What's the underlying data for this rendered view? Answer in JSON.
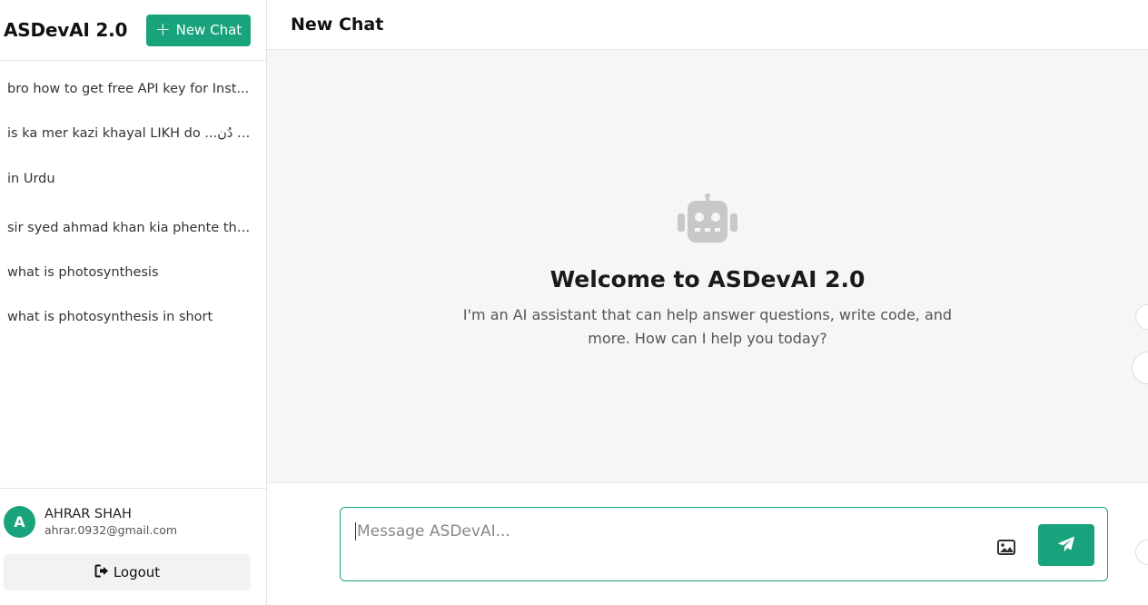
{
  "sidebar": {
    "brand": "ASDevAI 2.0",
    "new_chat_label": "New Chat",
    "history": [
      "bro how to get free API key for Inst...",
      "is ka mer kazi khayal LIKH do ...اری دُن",
      "in Urdu",
      "sir syed ahmad khan kia phente the...",
      "what is photosynthesis",
      "what is photosynthesis in short"
    ],
    "user": {
      "initial": "A",
      "name": "AHRAR SHAH",
      "email": "ahrar.0932@gmail.com"
    },
    "logout_label": "Logout"
  },
  "main": {
    "title": "New Chat",
    "welcome_title": "Welcome to ASDevAI 2.0",
    "welcome_text": "I'm an AI assistant that can help answer questions, write code, and more. How can I help you today?",
    "input_placeholder": "Message ASDevAI...",
    "input_value": ""
  },
  "icons": {
    "new_chat": "plus-icon",
    "logout": "sign-out-icon",
    "welcome": "robot-icon",
    "attach": "image-icon",
    "send": "paper-plane-icon"
  },
  "colors": {
    "accent": "#19a37d",
    "chat_background": "#f6f6f6",
    "robot_icon": "#c8c8c8"
  }
}
